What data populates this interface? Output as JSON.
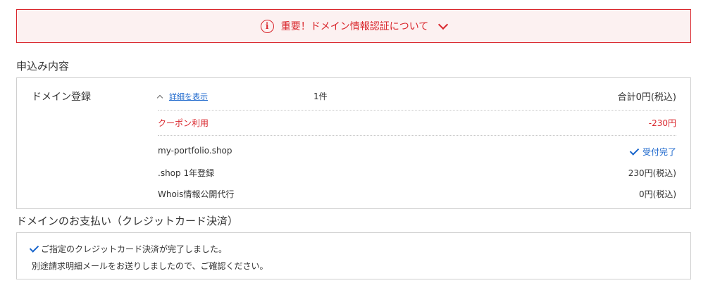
{
  "alert": {
    "icon": "info-icon",
    "text": "重要！ドメイン情報認証について",
    "color": "#d9262c"
  },
  "order": {
    "title": "申込み内容",
    "product": "ドメイン登録",
    "details_link": "詳細を表示",
    "count": "1件",
    "total": "合計0円(税込)",
    "coupon": {
      "label": "クーポン利用",
      "value": "-230円"
    },
    "items": [
      {
        "label": "my-portfolio.shop",
        "value": "受付完了"
      },
      {
        "label": ".shop 1年登録",
        "value": "230円(税込)"
      },
      {
        "label": "Whois情報公開代行",
        "value": "0円(税込)"
      }
    ]
  },
  "payment": {
    "title": "ドメインのお支払い（クレジットカード決済）",
    "line1": "ご指定のクレジットカード決済が完了しました。",
    "line2": "別途請求明細メールをお送りしましたので、ご確認ください。"
  }
}
